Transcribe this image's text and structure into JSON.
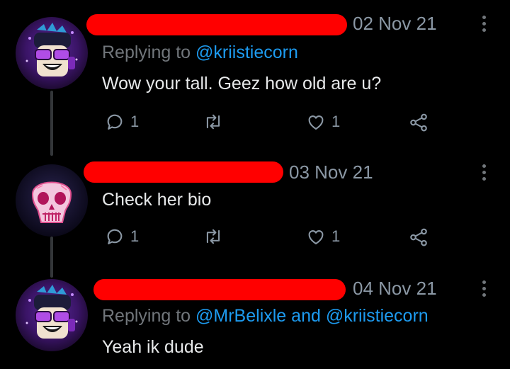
{
  "colors": {
    "background": "#000000",
    "text": "#e7e9ea",
    "secondary_text": "#71767b",
    "mention": "#1d9bf0",
    "redaction": "#ff0000",
    "thread_line": "#333639"
  },
  "tweets": [
    {
      "avatar": "avatar-purple-cartoon-icon",
      "date": "02 Nov 21",
      "reply_prefix": "Replying to ",
      "reply_mention_1": "@kriistiecorn",
      "text": "Wow your tall. Geez how old are u?",
      "reply_count": "1",
      "like_count": "1"
    },
    {
      "avatar": "avatar-pink-skull-icon",
      "date": "03 Nov 21",
      "text": "Check her bio",
      "reply_count": "1",
      "like_count": "1"
    },
    {
      "avatar": "avatar-purple-cartoon-icon",
      "date": "04 Nov 21",
      "reply_prefix": "Replying to ",
      "reply_mention_1": "@MrBelixle",
      "reply_joiner": " and ",
      "reply_mention_2": "@kriistiecorn",
      "text": "Yeah ik dude"
    }
  ]
}
